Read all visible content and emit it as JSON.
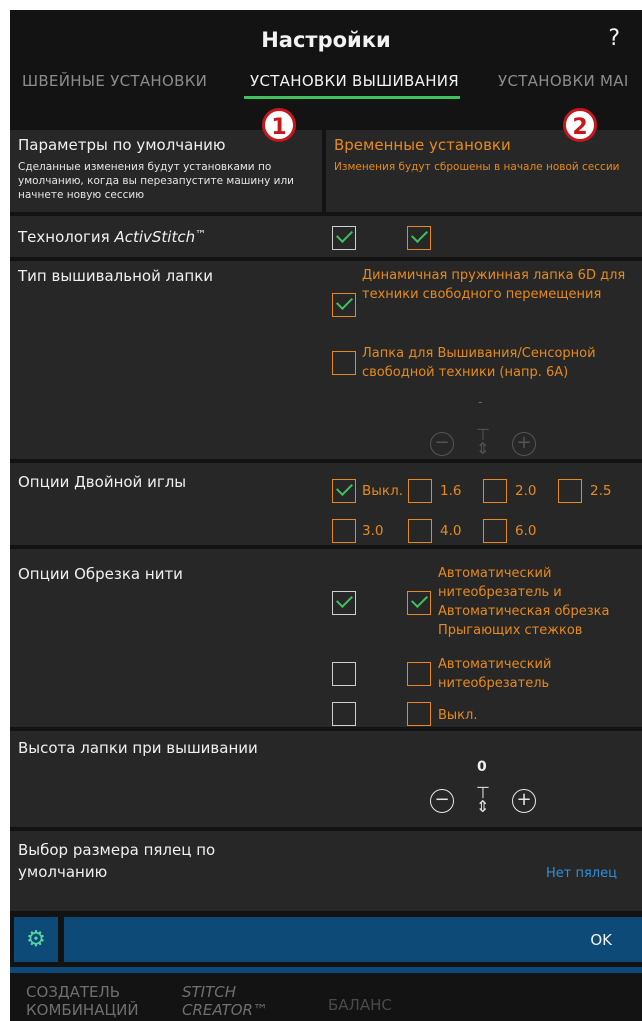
{
  "header": {
    "title": "Настройки",
    "help": "?"
  },
  "tabs": [
    {
      "label": "ШВЕЙНЫЕ УСТАНОВКИ"
    },
    {
      "label": "УСТАНОВКИ ВЫШИВАНИЯ"
    },
    {
      "label": "УСТАНОВКИ МАI"
    }
  ],
  "defaults": {
    "title": "Параметры по умолчанию",
    "description": "Сделанные изменения будут установками по умолчанию, когда вы перезапустите машину или начнете новую сессию",
    "marker": "1"
  },
  "temporary": {
    "title": "Временные установки",
    "description": "Изменения будут сброшены в начале новой сессии",
    "marker": "2"
  },
  "activstitch": {
    "label_prefix": "Технология ",
    "label_italic": "ActivStitch",
    "label_tm": "™"
  },
  "foot_type": {
    "label": "Тип вышивальной лапки",
    "option1": "Динамичная пружинная лапка 6D для техники свободного перемещения",
    "option2": "Лапка для Вышивания/Сенсорной свободной техники (напр. 6А)",
    "value": "-"
  },
  "twin_needle": {
    "label": "Опции Двойной иглы",
    "options": [
      "Выкл.",
      "1.6",
      "2.0",
      "2.5",
      "3.0",
      "4.0",
      "6.0"
    ]
  },
  "thread_cut": {
    "label": "Опции Обрезка нити",
    "option1": "Автоматический нитеобрезатель и Автоматическая обрезка Прыгающих стежков",
    "option2": "Автоматический нитеобрезатель",
    "option3": "Выкл."
  },
  "presser_height": {
    "label": "Высота лапки при вышивании",
    "value": "0"
  },
  "hoop_size": {
    "label": "Выбор размера пялец по умолчанию",
    "value": "Нет пялец"
  },
  "footer": {
    "ok_label": "OK"
  },
  "bottom_tabs": {
    "combo_line1": "СОЗДАТЕЛЬ",
    "combo_line2": "КОМБИНАЦИЙ",
    "stitch_line1": "STITCH",
    "stitch_line2": "CREATOR™",
    "balance": "БАЛАНС"
  },
  "colors": {
    "accent": "#e68a1f",
    "check": "#3fc15e",
    "tab_underline": "#3fc15e",
    "footer_blue": "#0e4a78",
    "link": "#2f8fd8"
  }
}
